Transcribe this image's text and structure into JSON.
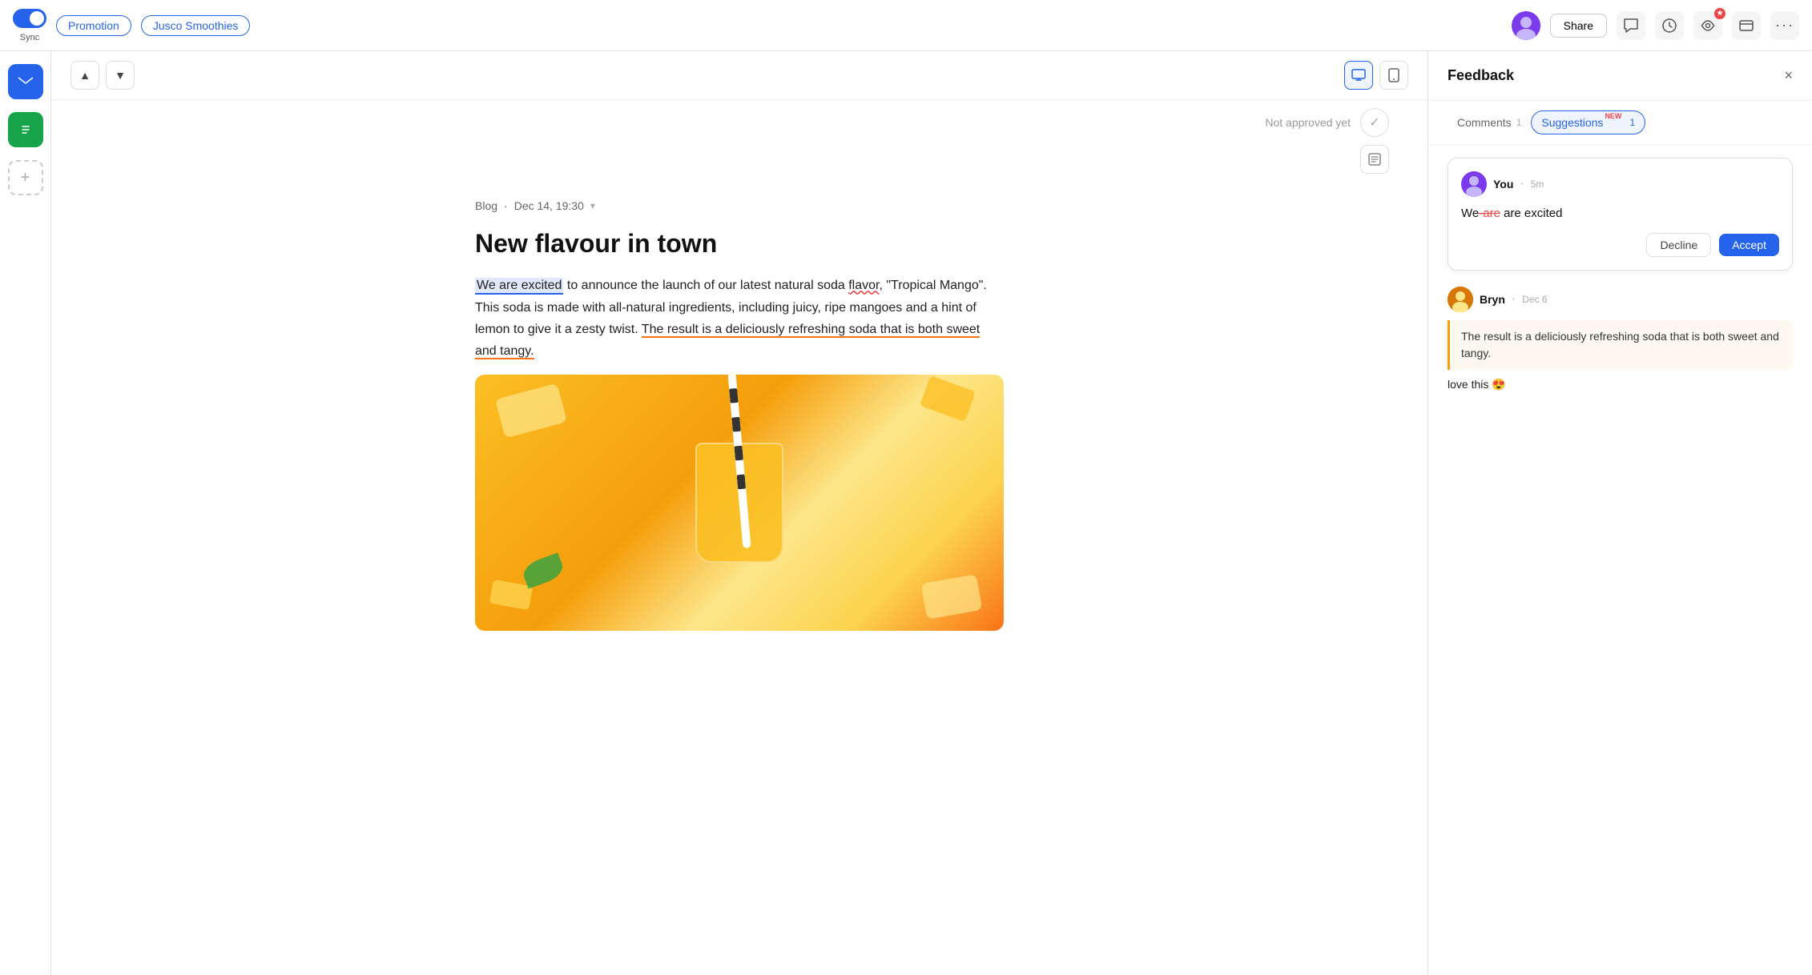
{
  "topbar": {
    "sync_label": "Sync",
    "tag_promotion": "Promotion",
    "tag_company": "Jusco Smoothies",
    "share_label": "Share"
  },
  "sidebar": {
    "icons": [
      "✉",
      "📄",
      "+"
    ]
  },
  "toolbar": {
    "up_label": "▲",
    "down_label": "▼",
    "desktop_label": "🖥",
    "mobile_label": "📱"
  },
  "approval": {
    "not_approved": "Not approved yet",
    "check_label": "✓"
  },
  "document": {
    "meta_type": "Blog",
    "meta_date": "Dec 14, 19:30",
    "title": "New flavour in town",
    "body_p1_before": "to announce the launch of our latest natural soda ",
    "body_p1_highlighted": "We are excited",
    "body_p1_flavour": "flavor",
    "body_p1_after": ", \"Tropical Mango\". This soda is made with all-natural ingredients, including juicy, ripe mangoes and a hint of lemon to give it a zesty twist. ",
    "body_p1_orange": "The result is a deliciously refreshing soda that is both sweet and tangy.",
    "body_p1_end": ""
  },
  "feedback": {
    "panel_title": "Feedback",
    "close_label": "×",
    "tab_comments": "Comments",
    "tab_comments_count": "1",
    "tab_suggestions": "Suggestions",
    "tab_suggestions_count": "1",
    "tab_suggestions_badge": "NEW",
    "suggestion": {
      "user": "You",
      "time": "5m",
      "text_before": "We",
      "strikethrough": "-are",
      "text_after": " are excited",
      "decline_label": "Decline",
      "accept_label": "Accept"
    },
    "comment": {
      "user": "Bryn",
      "date": "Dec 6",
      "quoted_text": "The result is a deliciously refreshing soda that is both sweet and tangy.",
      "comment_text": "love this 😍"
    }
  }
}
